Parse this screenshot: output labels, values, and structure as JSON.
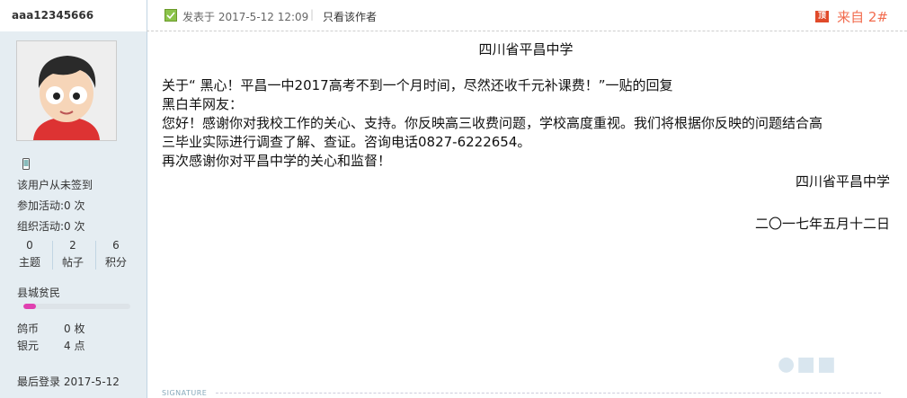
{
  "user": {
    "username": "aaa12345666",
    "checkin_text": "该用户从未签到",
    "activities_joined": "参加活动:0 次",
    "activities_organized": "组织活动:0 次",
    "stats": [
      {
        "value": "0",
        "label": "主题"
      },
      {
        "value": "2",
        "label": "帖子"
      },
      {
        "value": "6",
        "label": "积分"
      }
    ],
    "rank_title": "县城贫民",
    "rank_progress": 0.12,
    "currency": [
      {
        "label": "鸽币",
        "value": "0 枚"
      },
      {
        "label": "银元",
        "value": "4 点"
      }
    ],
    "last_login": "最后登录  2017-5-12"
  },
  "post": {
    "posted_at": "发表于 2017-5-12 12:09",
    "separator": "|",
    "only_author": "只看该作者",
    "from_icon_text": "顶",
    "floor": "来自 2#",
    "title": "四川省平昌中学",
    "lines": [
      "关于“ 黑心！平昌一中2017高考不到一个月时间，尽然还收千元补课费！”一贴的回复",
      "黑白羊网友：",
      "您好！感谢你对我校工作的关心、支持。你反映高三收费问题，学校高度重视。我们将根据你反映的问题结合高",
      "三毕业实际进行调查了解、查证。咨询电话0827-6222654。",
      "再次感谢你对平昌中学的关心和监督！"
    ],
    "signature_org": "四川省平昌中学",
    "signature_date": "二〇一七年五月十二日"
  },
  "signature_label": "SIGNATURE",
  "colors": {
    "sidebar_bg": "#e5edf2",
    "accent": "#f26c4f",
    "rank_fill": "#e040b0"
  }
}
